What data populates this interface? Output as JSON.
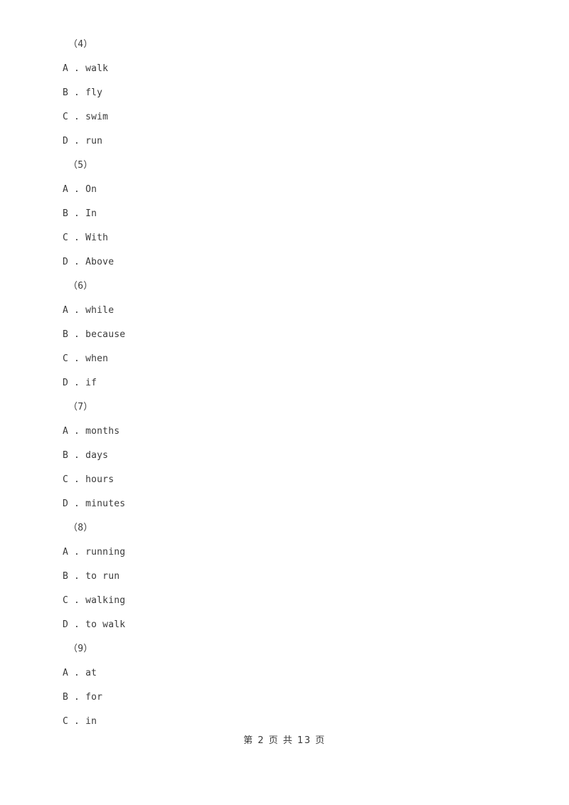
{
  "page": {
    "footer_text": "第 2 页 共 13 页",
    "page_number": "2",
    "total_pages": "13"
  },
  "questions": [
    {
      "number": "（4）",
      "options": [
        "A . walk",
        "B . fly",
        "C . swim",
        "D . run"
      ]
    },
    {
      "number": "（5）",
      "options": [
        "A . On",
        "B . In",
        "C . With",
        "D . Above"
      ]
    },
    {
      "number": "（6）",
      "options": [
        "A . while",
        "B . because",
        "C . when",
        "D . if"
      ]
    },
    {
      "number": "（7）",
      "options": [
        "A . months",
        "B . days",
        "C . hours",
        "D . minutes"
      ]
    },
    {
      "number": "（8）",
      "options": [
        "A . running",
        "B . to run",
        "C . walking",
        "D . to walk"
      ]
    },
    {
      "number": "（9）",
      "options": [
        "A . at",
        "B . for",
        "C . in"
      ]
    }
  ]
}
